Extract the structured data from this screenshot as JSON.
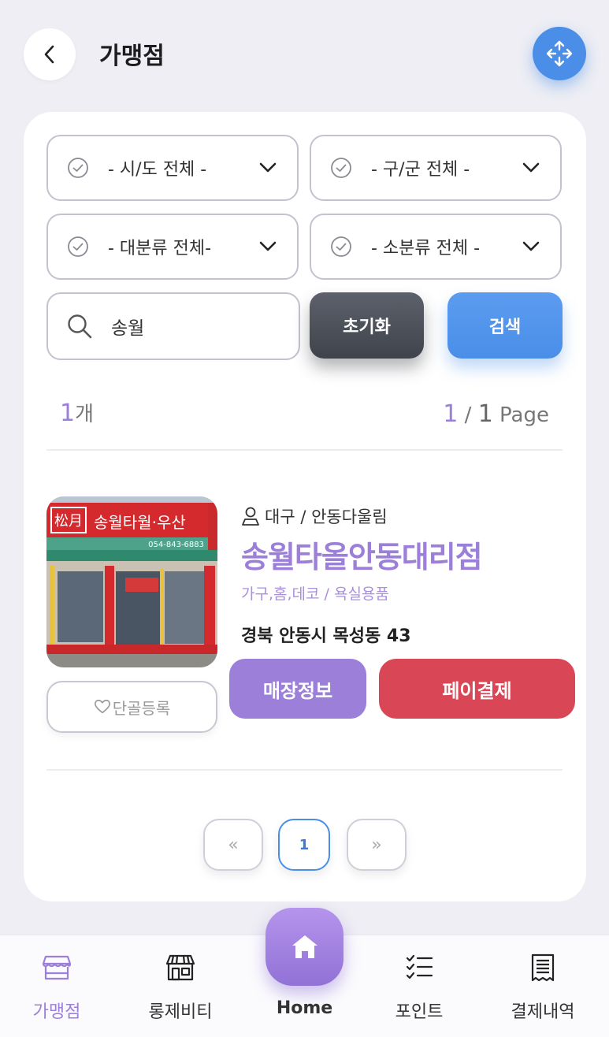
{
  "header": {
    "title": "가맹점"
  },
  "filters": {
    "region": "- 시/도 전체 -",
    "district": "- 구/군 전체 -",
    "major_category": "- 대분류 전체-",
    "minor_category": "- 소분류 전체 -"
  },
  "search": {
    "value": "송월",
    "reset_label": "초기화",
    "search_label": "검색"
  },
  "results": {
    "count": "1",
    "count_unit": "개",
    "current_page": "1",
    "separator": " / ",
    "total_pages": "1",
    "page_word": " Page"
  },
  "store": {
    "region": "대구 / 안동다울림",
    "name": "송월타올안동대리점",
    "category": "가구,홈,데코 / 욕실용품",
    "address": "경북 안동시 목성동 43",
    "favorite_label": "단골등록",
    "info_label": "매장정보",
    "pay_label": "페이결제",
    "sign_text": "송월타월·우산",
    "sign_brand": "松月",
    "sign_phone": "054-843-6883"
  },
  "pagination": {
    "prev": "«",
    "page": "1",
    "next": "»"
  },
  "nav": {
    "store": "가맹점",
    "community": "롱제비티",
    "home": "Home",
    "point": "포인트",
    "history": "결제내역"
  },
  "colors": {
    "accent_purple": "#9b7fd8",
    "accent_blue": "#4a8ee8",
    "pay_red": "#d94656",
    "reset_dark": "#4a4e56"
  }
}
